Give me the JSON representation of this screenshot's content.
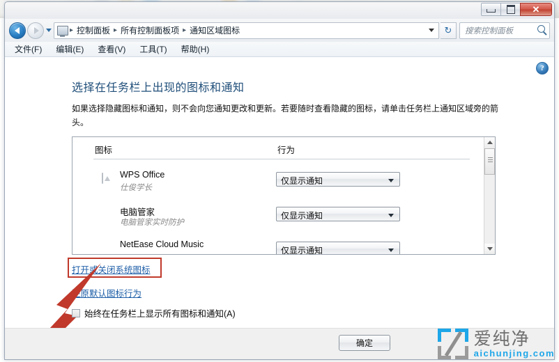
{
  "window": {
    "buttons": {
      "minimize": "minimize",
      "maximize": "maximize",
      "close": "✕"
    }
  },
  "addressbar": {
    "breadcrumbs": [
      "控制面板",
      "所有控制面板项",
      "通知区域图标"
    ],
    "separator": "▸",
    "blurred_tail": "",
    "refresh_label": "↻"
  },
  "search": {
    "placeholder": "搜索控制面板",
    "value": ""
  },
  "menubar": {
    "items": [
      "文件(F)",
      "编辑(E)",
      "查看(V)",
      "工具(T)",
      "帮助(H)"
    ]
  },
  "content": {
    "help_label": "?",
    "title": "选择在任务栏上出现的图标和通知",
    "description": "如果选择隐藏图标和通知，则不会向您通知更改和更新。若要随时查看隐藏的图标，请单击任务栏上通知区域旁的箭头。"
  },
  "list": {
    "columns": [
      "图标",
      "行为"
    ],
    "rows": [
      {
        "icon": "wps-office-icon",
        "name": "WPS Office",
        "subtitle": "仕俊学长",
        "behavior": "仅显示通知"
      },
      {
        "icon": "pc-manager-shield-icon",
        "name": "电脑管家",
        "subtitle": "电脑管家实时防护",
        "behavior": "仅显示通知"
      },
      {
        "icon": "netease-cloud-music-icon",
        "name": "NetEase Cloud Music",
        "subtitle": "",
        "behavior": "仅显示通知"
      }
    ]
  },
  "links": {
    "system_icons": "打开或关闭系统图标",
    "restore_default": "还原默认图标行为"
  },
  "checkbox": {
    "label": "始终在任务栏上显示所有图标和通知(A)",
    "checked": false
  },
  "footer": {
    "ok_label": "确定"
  },
  "annotation": {
    "highlight_color": "#c0392b",
    "arrow_color": "#c0392b"
  },
  "watermark": {
    "cn": "爱纯净",
    "en": "aichunjing.com",
    "accent_color": "#1da6e8"
  }
}
